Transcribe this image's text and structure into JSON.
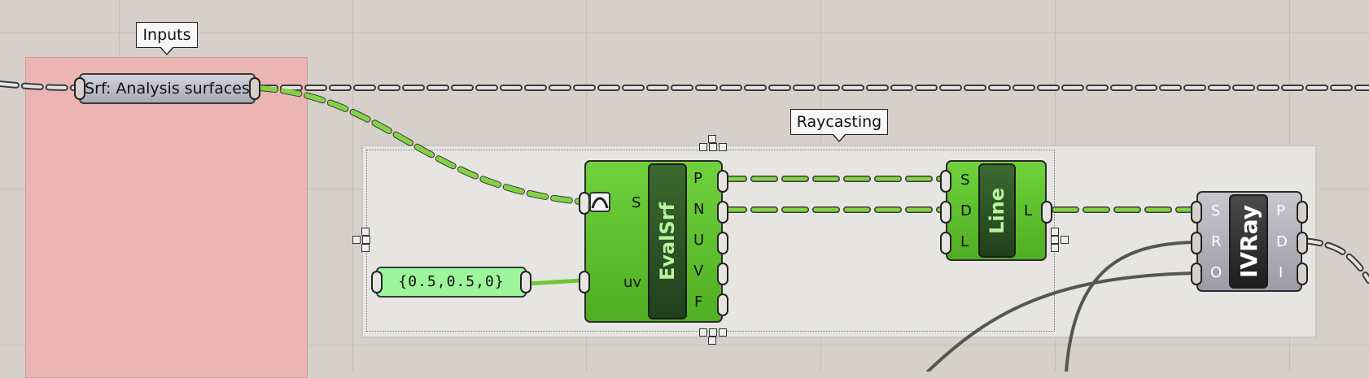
{
  "canvas": {
    "background": "#d5d1ca"
  },
  "groups": {
    "inputs": {
      "title": "Inputs",
      "color": "#ebb5b3"
    },
    "raycasting": {
      "title": "Raycasting",
      "color": "#e6e5e1"
    }
  },
  "params": {
    "srf": {
      "label": "Srf: Analysis surfaces"
    },
    "panel": {
      "value": "{0.5,0.5,0}"
    }
  },
  "components": {
    "evalsrf": {
      "name": "EvalSrf",
      "inputs": [
        "S",
        "uv"
      ],
      "outputs": [
        "P",
        "N",
        "U",
        "V",
        "F"
      ],
      "color": "#5cbf2b"
    },
    "line": {
      "name": "Line",
      "inputs": [
        "S",
        "D",
        "L"
      ],
      "outputs": [
        "L"
      ],
      "color": "#5cbf2b"
    },
    "ivray": {
      "name": "IVRay",
      "inputs": [
        "S",
        "R",
        "O"
      ],
      "outputs": [
        "P",
        "D",
        "I"
      ],
      "color": "#a6a6b2"
    }
  },
  "wire_colors": {
    "default": "#525252",
    "selected": "#83d245"
  },
  "icons": [
    "surface-param-icon",
    "selection-handle-icon"
  ]
}
